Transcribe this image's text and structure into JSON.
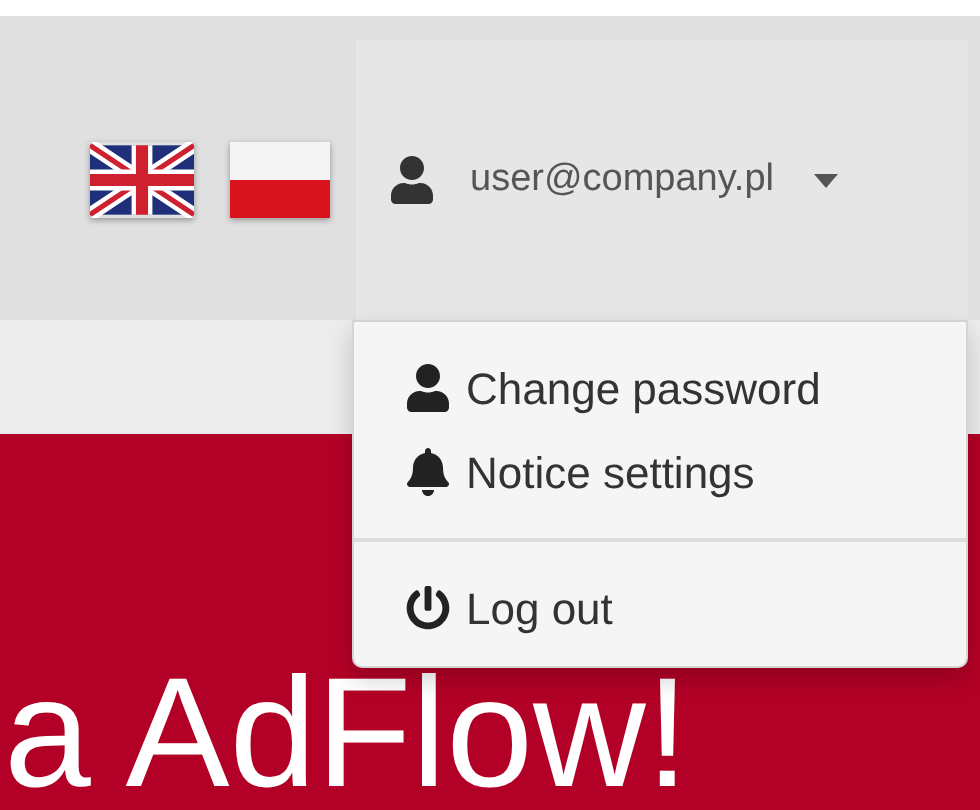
{
  "navbar": {
    "user": {
      "email": "user@company.pl"
    }
  },
  "user_menu": {
    "groups": [
      [
        "Change password",
        "Notice settings"
      ],
      [
        "Log out"
      ]
    ]
  },
  "hero": {
    "heading": "a AdFlow!"
  }
}
